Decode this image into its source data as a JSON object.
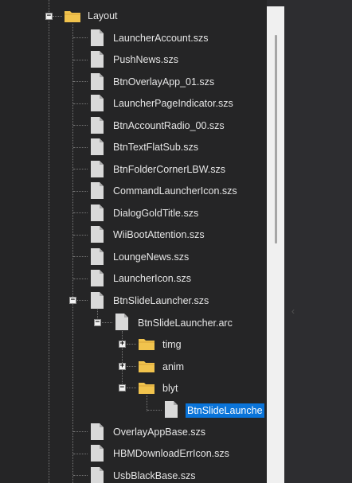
{
  "tree": {
    "root": {
      "label": "Layout",
      "expanded": true
    },
    "items": [
      {
        "label": "LauncherAccount.szs",
        "icon": "file-icon"
      },
      {
        "label": "PushNews.szs",
        "icon": "file-icon"
      },
      {
        "label": "BtnOverlayApp_01.szs",
        "icon": "file-icon"
      },
      {
        "label": "LauncherPageIndicator.szs",
        "icon": "file-icon"
      },
      {
        "label": "BtnAccountRadio_00.szs",
        "icon": "file-icon"
      },
      {
        "label": "BtnTextFlatSub.szs",
        "icon": "file-icon"
      },
      {
        "label": "BtnFolderCornerLBW.szs",
        "icon": "file-icon"
      },
      {
        "label": "CommandLauncherIcon.szs",
        "icon": "file-icon"
      },
      {
        "label": "DialogGoldTitle.szs",
        "icon": "file-icon"
      },
      {
        "label": "WiiBootAttention.szs",
        "icon": "file-icon"
      },
      {
        "label": "LoungeNews.szs",
        "icon": "file-icon"
      },
      {
        "label": "LauncherIcon.szs",
        "icon": "file-icon"
      },
      {
        "label": "BtnSlideLauncher.szs",
        "icon": "file-icon",
        "expanded": true
      },
      {
        "label": "BtnSlideLauncher.arc",
        "icon": "file-icon",
        "expanded": true
      },
      {
        "label": "timg",
        "icon": "folder-icon",
        "expanded": false
      },
      {
        "label": "anim",
        "icon": "folder-icon",
        "expanded": false
      },
      {
        "label": "blyt",
        "icon": "folder-icon",
        "expanded": true
      },
      {
        "label": "BtnSlideLaunche",
        "icon": "file-icon",
        "selected": true
      },
      {
        "label": "OverlayAppBase.szs",
        "icon": "file-icon"
      },
      {
        "label": "HBMDownloadErrIcon.szs",
        "icon": "file-icon"
      },
      {
        "label": "UsbBlackBase.szs",
        "icon": "file-icon"
      }
    ]
  },
  "colors": {
    "tree_background": "#252526",
    "selection": "#0a74d9",
    "folder": "#f1c34d",
    "file": "#d9d9d9"
  }
}
